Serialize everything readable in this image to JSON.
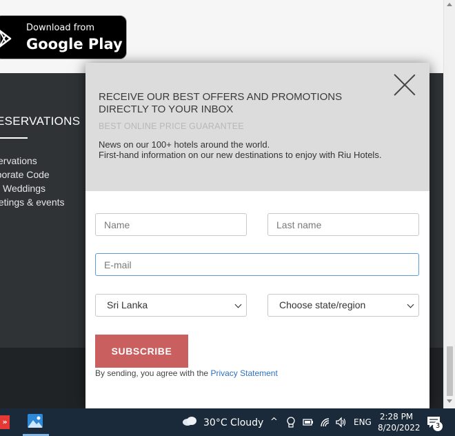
{
  "google_play": {
    "small": "Download from",
    "big": "Google Play"
  },
  "footer": {
    "reservations_title": "ESERVATIONS",
    "items": [
      "servations",
      "rporate Code",
      "U Weddings",
      "eetings & events"
    ]
  },
  "modal": {
    "title": "RECEIVE OUR BEST OFFERS AND PROMOTIONS DIRECTLY TO YOUR INBOX",
    "guarantee": "BEST ONLINE PRICE GUARANTEE",
    "news": "News on our 100+ hotels around the world.",
    "info": "First-hand information on our new destinations to enjoy with Riu Hotels.",
    "name_placeholder": "Name",
    "lastname_placeholder": "Last name",
    "email_placeholder": "E-mail",
    "country_selected": "Sri Lanka",
    "region_selected": "Choose state/region",
    "subscribe_label": "SUBSCRIBE",
    "agree_text": "By sending, you agree with the ",
    "privacy_link": "Privacy Statement"
  },
  "taskbar": {
    "weather": "30°C  Cloudy",
    "lang": "ENG",
    "time": "2:28 PM",
    "date": "8/20/2022",
    "notifications": "3"
  },
  "colors": {
    "subscribe": "#c95f5e",
    "footer": "#2f3336",
    "link": "#2d6fc1",
    "taskbar": "#1b2a3a"
  }
}
